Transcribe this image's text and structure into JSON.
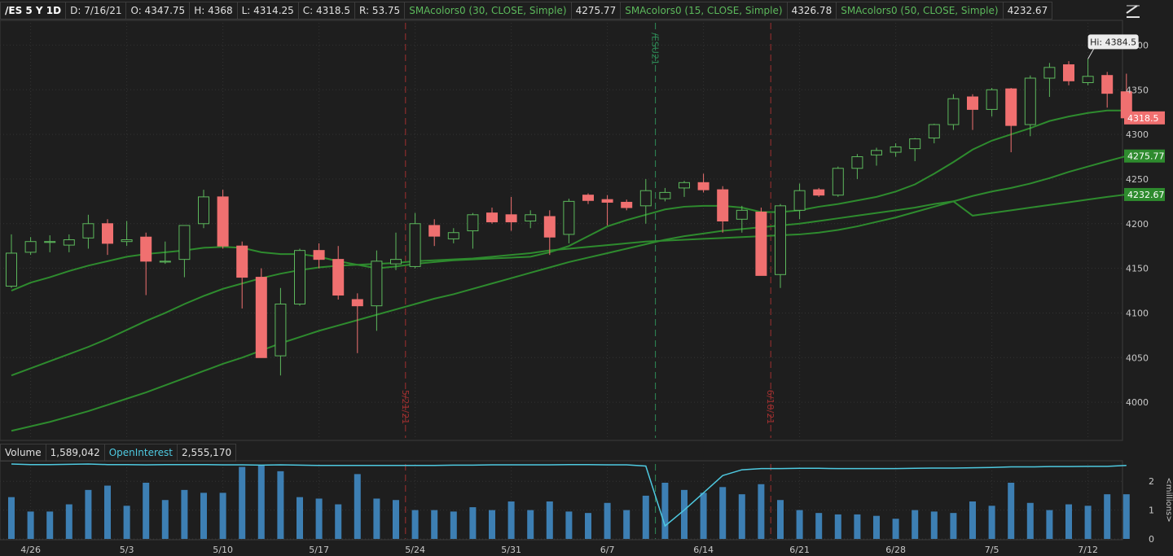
{
  "header": {
    "symbol": "/ES 5 Y 1D",
    "date": "D: 7/16/21",
    "open": "O: 4347.75",
    "high": "H: 4368",
    "low": "L: 4314.25",
    "close": "C: 4318.5",
    "range": "R: 53.75",
    "studies": [
      {
        "label": "SMAcolors0 (30, CLOSE, Simple)",
        "value": "4275.77"
      },
      {
        "label": "SMAcolors0 (15, CLOSE, Simple)",
        "value": "4326.78"
      },
      {
        "label": "SMAcolors0 (50, CLOSE, Simple)",
        "value": "4232.67"
      }
    ]
  },
  "volume_header": {
    "volume_label": "Volume",
    "volume_value": "1,589,042",
    "oi_label": "OpenInterest",
    "oi_value": "2,555,170"
  },
  "colors": {
    "up": "#5cb85c",
    "down": "#f07070",
    "sma": "#2e8b2e",
    "volume": "#3d7fb3",
    "oi": "#4ec9e0",
    "grid": "#333333"
  },
  "chart_data": {
    "type": "candlestick",
    "price_ylim": [
      3960,
      4425
    ],
    "y_ticks": [
      4000,
      4050,
      4100,
      4150,
      4200,
      4250,
      4300,
      4350,
      4400
    ],
    "x_ticks": [
      "4/26",
      "5/3",
      "5/10",
      "5/17",
      "5/24",
      "5/31",
      "6/7",
      "6/14",
      "6/21",
      "6/28",
      "7/5",
      "7/12"
    ],
    "candles": [
      {
        "o": 4130,
        "h": 4188,
        "l": 4128,
        "c": 4167
      },
      {
        "o": 4168,
        "h": 4185,
        "l": 4165,
        "c": 4180
      },
      {
        "o": 4179,
        "h": 4187,
        "l": 4168,
        "c": 4180
      },
      {
        "o": 4176,
        "h": 4188,
        "l": 4168,
        "c": 4182
      },
      {
        "o": 4184,
        "h": 4210,
        "l": 4172,
        "c": 4200
      },
      {
        "o": 4200,
        "h": 4205,
        "l": 4165,
        "c": 4178
      },
      {
        "o": 4180,
        "h": 4203,
        "l": 4175,
        "c": 4182
      },
      {
        "o": 4185,
        "h": 4190,
        "l": 4120,
        "c": 4158
      },
      {
        "o": 4157,
        "h": 4180,
        "l": 4155,
        "c": 4158
      },
      {
        "o": 4160,
        "h": 4198,
        "l": 4140,
        "c": 4198
      },
      {
        "o": 4200,
        "h": 4238,
        "l": 4195,
        "c": 4230
      },
      {
        "o": 4230,
        "h": 4238,
        "l": 4172,
        "c": 4175
      },
      {
        "o": 4175,
        "h": 4180,
        "l": 4105,
        "c": 4140
      },
      {
        "o": 4140,
        "h": 4150,
        "l": 4050,
        "c": 4050
      },
      {
        "o": 4052,
        "h": 4128,
        "l": 4030,
        "c": 4110
      },
      {
        "o": 4110,
        "h": 4172,
        "l": 4108,
        "c": 4170
      },
      {
        "o": 4170,
        "h": 4178,
        "l": 4150,
        "c": 4160
      },
      {
        "o": 4160,
        "h": 4175,
        "l": 4115,
        "c": 4120
      },
      {
        "o": 4115,
        "h": 4122,
        "l": 4055,
        "c": 4108
      },
      {
        "o": 4108,
        "h": 4170,
        "l": 4080,
        "c": 4158
      },
      {
        "o": 4155,
        "h": 4190,
        "l": 4148,
        "c": 4160
      },
      {
        "o": 4152,
        "h": 4212,
        "l": 4150,
        "c": 4200
      },
      {
        "o": 4198,
        "h": 4205,
        "l": 4175,
        "c": 4186
      },
      {
        "o": 4183,
        "h": 4195,
        "l": 4178,
        "c": 4190
      },
      {
        "o": 4192,
        "h": 4212,
        "l": 4172,
        "c": 4210
      },
      {
        "o": 4212,
        "h": 4218,
        "l": 4200,
        "c": 4202
      },
      {
        "o": 4210,
        "h": 4230,
        "l": 4192,
        "c": 4202
      },
      {
        "o": 4203,
        "h": 4215,
        "l": 4195,
        "c": 4210
      },
      {
        "o": 4208,
        "h": 4215,
        "l": 4165,
        "c": 4185
      },
      {
        "o": 4188,
        "h": 4228,
        "l": 4178,
        "c": 4225
      },
      {
        "o": 4232,
        "h": 4234,
        "l": 4222,
        "c": 4226
      },
      {
        "o": 4227,
        "h": 4232,
        "l": 4198,
        "c": 4224
      },
      {
        "o": 4224,
        "h": 4227,
        "l": 4215,
        "c": 4218
      },
      {
        "o": 4220,
        "h": 4250,
        "l": 4200,
        "c": 4237
      },
      {
        "o": 4228,
        "h": 4240,
        "l": 4225,
        "c": 4235
      },
      {
        "o": 4240,
        "h": 4248,
        "l": 4230,
        "c": 4246
      },
      {
        "o": 4246,
        "h": 4256,
        "l": 4235,
        "c": 4238
      },
      {
        "o": 4238,
        "h": 4242,
        "l": 4190,
        "c": 4203
      },
      {
        "o": 4205,
        "h": 4220,
        "l": 4190,
        "c": 4215
      },
      {
        "o": 4213,
        "h": 4218,
        "l": 4150,
        "c": 4142
      },
      {
        "o": 4143,
        "h": 4222,
        "l": 4128,
        "c": 4220
      },
      {
        "o": 4215,
        "h": 4245,
        "l": 4205,
        "c": 4237
      },
      {
        "o": 4238,
        "h": 4240,
        "l": 4230,
        "c": 4232
      },
      {
        "o": 4232,
        "h": 4264,
        "l": 4230,
        "c": 4262
      },
      {
        "o": 4262,
        "h": 4278,
        "l": 4250,
        "c": 4275
      },
      {
        "o": 4277,
        "h": 4285,
        "l": 4265,
        "c": 4282
      },
      {
        "o": 4280,
        "h": 4290,
        "l": 4275,
        "c": 4286
      },
      {
        "o": 4284,
        "h": 4296,
        "l": 4270,
        "c": 4295
      },
      {
        "o": 4296,
        "h": 4312,
        "l": 4290,
        "c": 4311
      },
      {
        "o": 4311,
        "h": 4345,
        "l": 4305,
        "c": 4340
      },
      {
        "o": 4342,
        "h": 4345,
        "l": 4305,
        "c": 4328
      },
      {
        "o": 4328,
        "h": 4352,
        "l": 4320,
        "c": 4350
      },
      {
        "o": 4351,
        "h": 4352,
        "l": 4280,
        "c": 4310
      },
      {
        "o": 4311,
        "h": 4366,
        "l": 4298,
        "c": 4363
      },
      {
        "o": 4363,
        "h": 4380,
        "l": 4342,
        "c": 4375
      },
      {
        "o": 4378,
        "h": 4382,
        "l": 4355,
        "c": 4360
      },
      {
        "o": 4358,
        "h": 4384.5,
        "l": 4355,
        "c": 4365
      },
      {
        "o": 4366,
        "h": 4370,
        "l": 4330,
        "c": 4346
      },
      {
        "o": 4347.75,
        "h": 4368,
        "l": 4314.25,
        "c": 4318.5
      }
    ],
    "sma_lines": [
      {
        "name": "SMAcolors0 (15, CLOSE, Simple)",
        "values": [
          4125,
          4134,
          4140,
          4147,
          4153,
          4158,
          4163,
          4166,
          4168,
          4170,
          4173,
          4174,
          4173,
          4168,
          4166,
          4166,
          4163,
          4158,
          4154,
          4150,
          4152,
          4155,
          4157,
          4159,
          4160,
          4161,
          4162,
          4163,
          4168,
          4175,
          4186,
          4197,
          4204,
          4210,
          4216,
          4219,
          4220,
          4220,
          4218,
          4213,
          4213,
          4215,
          4219,
          4222,
          4226,
          4230,
          4236,
          4244,
          4256,
          4269,
          4283,
          4293,
          4300,
          4307,
          4315,
          4320,
          4324,
          4326.78,
          4326.78
        ]
      },
      {
        "name": "SMAcolors0 (30, CLOSE, Simple)",
        "values": [
          4030,
          4038,
          4046,
          4054,
          4062,
          4071,
          4081,
          4091,
          4100,
          4110,
          4119,
          4127,
          4133,
          4139,
          4144,
          4148,
          4151,
          4153,
          4154,
          4155,
          4156,
          4158,
          4159,
          4160,
          4161,
          4163,
          4165,
          4167,
          4170,
          4172,
          4174,
          4176,
          4178,
          4180,
          4181,
          4182,
          4183,
          4184,
          4185,
          4186,
          4187,
          4188,
          4190,
          4193,
          4197,
          4202,
          4207,
          4213,
          4219,
          4225,
          4231,
          4236,
          4240,
          4245,
          4251,
          4258,
          4264,
          4270,
          4275.77
        ]
      },
      {
        "name": "SMAcolors0 (50, CLOSE, Simple)",
        "values": [
          3968,
          3973,
          3978,
          3984,
          3990,
          3997,
          4004,
          4011,
          4019,
          4027,
          4035,
          4043,
          4050,
          4058,
          4066,
          4073,
          4080,
          4086,
          4092,
          4098,
          4104,
          4110,
          4116,
          4121,
          4127,
          4133,
          4139,
          4145,
          4151,
          4157,
          4162,
          4167,
          4172,
          4177,
          4182,
          4186,
          4189,
          4192,
          4194,
          4196,
          4198,
          4200,
          4203,
          4206,
          4209,
          4212,
          4215,
          4218,
          4222,
          4225,
          4209,
          4212,
          4215,
          4218,
          4221,
          4224,
          4227,
          4230,
          4232.67
        ]
      }
    ],
    "price_labels": [
      "4318.5",
      "4275.77",
      "4232.67"
    ],
    "hi_label": "Hi: 4384.5",
    "vlines": [
      {
        "x_index": 20,
        "label": "5/21/21",
        "color": "#a03030"
      },
      {
        "x_index": 33,
        "label": "/ESU21",
        "color": "#2e8b57"
      },
      {
        "x_index": 39,
        "label": "6/18/21",
        "color": "#a03030"
      }
    ],
    "volume": {
      "ylim": [
        0,
        2.6
      ],
      "y_ticks": [
        0,
        1,
        2
      ],
      "unit_label": "<millions>",
      "values": [
        1.45,
        0.95,
        0.95,
        1.2,
        1.7,
        1.85,
        1.15,
        1.95,
        1.35,
        1.7,
        1.6,
        1.6,
        2.5,
        2.55,
        2.35,
        1.45,
        1.4,
        1.2,
        2.25,
        1.4,
        1.35,
        1.0,
        1.0,
        0.95,
        1.1,
        1.0,
        1.3,
        1.0,
        1.3,
        0.95,
        0.9,
        1.25,
        1.0,
        1.5,
        1.95,
        1.7,
        1.6,
        1.8,
        1.55,
        1.9,
        1.35,
        1.0,
        0.9,
        0.85,
        0.85,
        0.8,
        0.7,
        1.0,
        0.95,
        0.9,
        1.3,
        1.15,
        1.95,
        1.25,
        1.0,
        1.2,
        1.15,
        1.55,
        1.55
      ],
      "open_interest": [
        2.6,
        2.58,
        2.58,
        2.59,
        2.6,
        2.58,
        2.58,
        2.57,
        2.58,
        2.58,
        2.58,
        2.57,
        2.57,
        2.56,
        2.57,
        2.56,
        2.55,
        2.55,
        2.55,
        2.55,
        2.55,
        2.55,
        2.55,
        2.56,
        2.56,
        2.57,
        2.57,
        2.57,
        2.57,
        2.58,
        2.58,
        2.57,
        2.57,
        2.53,
        0.45,
        1.0,
        1.6,
        2.2,
        2.4,
        2.44,
        2.44,
        2.45,
        2.45,
        2.44,
        2.44,
        2.44,
        2.44,
        2.45,
        2.46,
        2.46,
        2.47,
        2.48,
        2.5,
        2.5,
        2.51,
        2.51,
        2.52,
        2.52,
        2.55
      ]
    }
  }
}
